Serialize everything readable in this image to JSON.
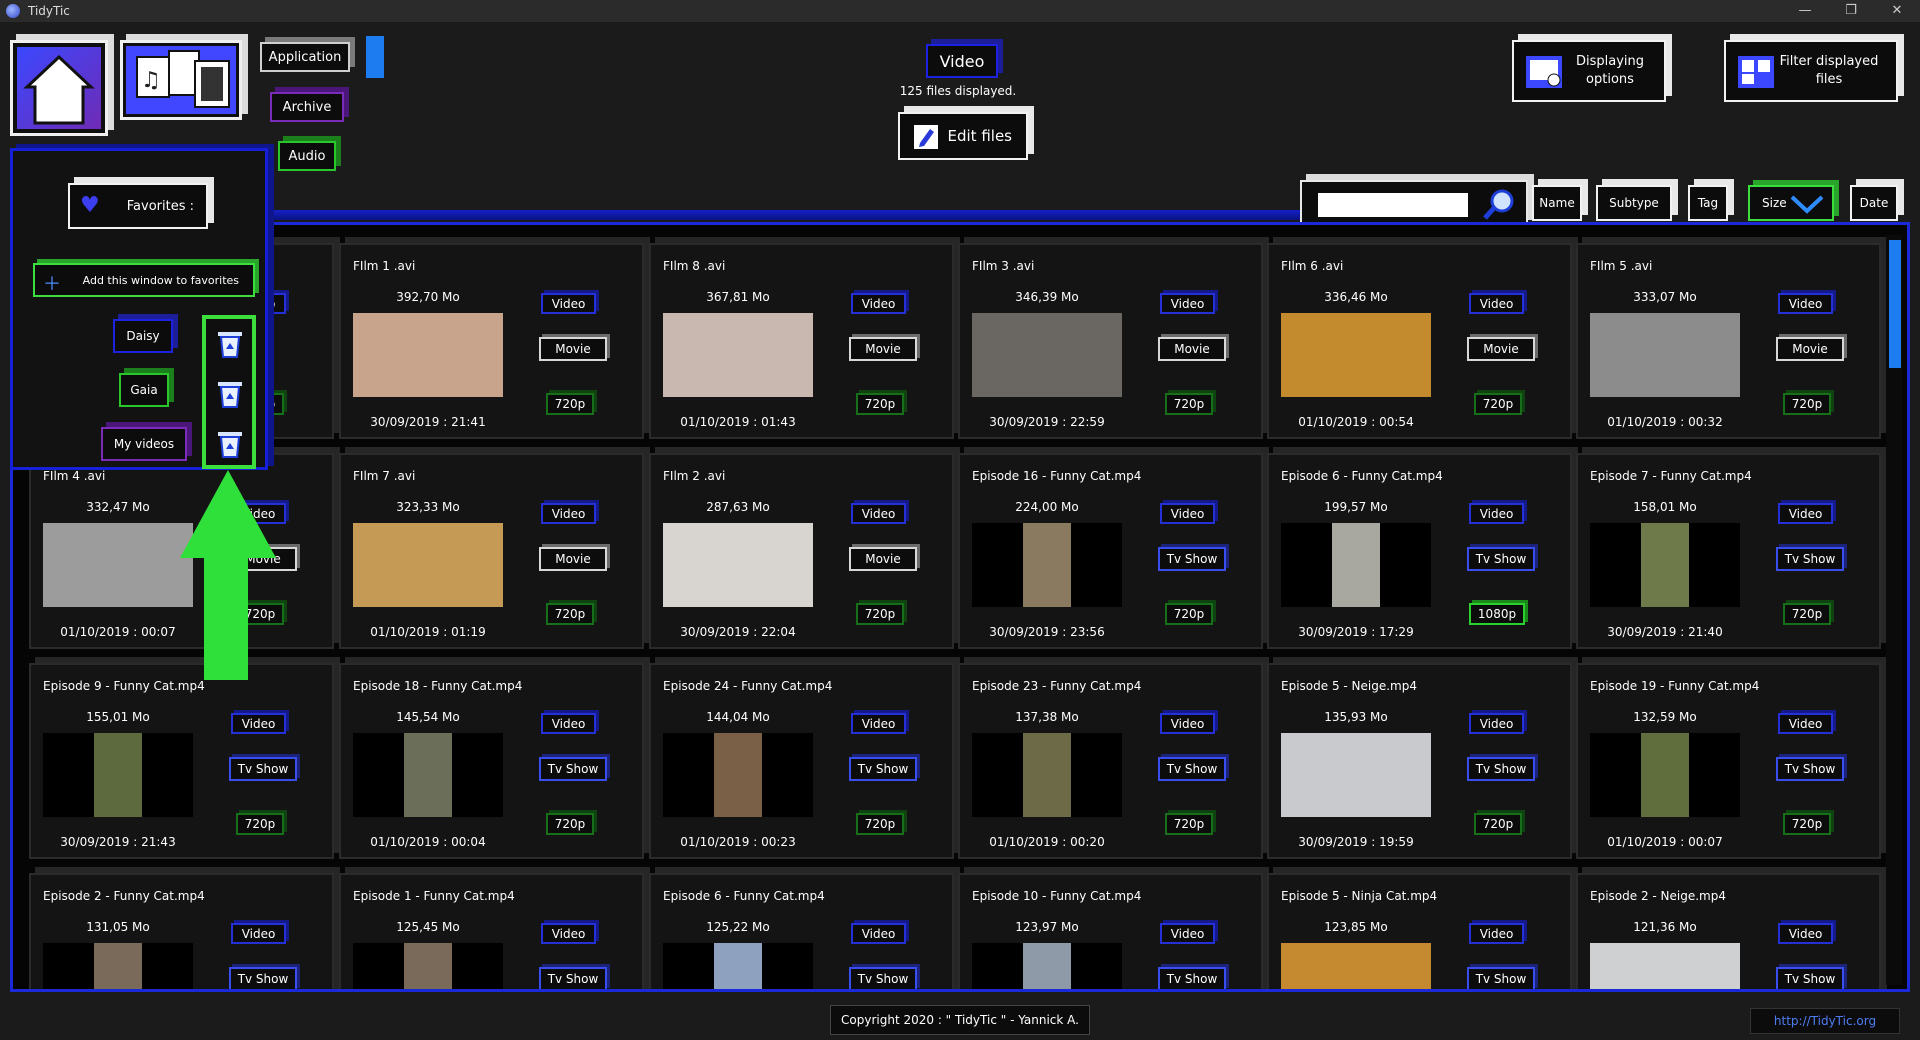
{
  "window": {
    "title": "TidyTic",
    "minimize": "—",
    "restore": "❐",
    "close": "✕"
  },
  "categories": {
    "application": "Application",
    "archive": "Archive",
    "audio": "Audio"
  },
  "current": {
    "category": "Video",
    "files_displayed": "125 files displayed.",
    "edit_files": "Edit files"
  },
  "toolbar": {
    "displaying_options": "Displaying options",
    "filter_displayed_files": "Filter displayed files"
  },
  "sort": {
    "name": "Name",
    "subtype": "Subtype",
    "tag": "Tag",
    "size": "Size",
    "date": "Date"
  },
  "search": {
    "value": ""
  },
  "favorites": {
    "header": "Favorites :",
    "add_button": "Add this window to favorites",
    "items": [
      "Daisy",
      "Gaia",
      "My videos"
    ],
    "colors": [
      "#1d22e0",
      "#29c72b",
      "#7a2bb7"
    ]
  },
  "files": [
    {
      "name": "",
      "size": "",
      "date": "",
      "type": "Video",
      "subtype": "",
      "res": "720p",
      "thumb": "#d7d2c6"
    },
    {
      "name": "FIlm 1 .avi",
      "size": "392,70 Mo",
      "date": "30/09/2019 : 21:41",
      "type": "Video",
      "subtype": "Movie",
      "res": "720p",
      "thumb": "#c9a48d"
    },
    {
      "name": "FIlm 8 .avi",
      "size": "367,81 Mo",
      "date": "01/10/2019 : 01:43",
      "type": "Video",
      "subtype": "Movie",
      "res": "720p",
      "thumb": "#c8b8b0"
    },
    {
      "name": "FIlm 3 .avi",
      "size": "346,39 Mo",
      "date": "30/09/2019 : 22:59",
      "type": "Video",
      "subtype": "Movie",
      "res": "720p",
      "thumb": "#6a6662"
    },
    {
      "name": "FIlm 6 .avi",
      "size": "336,46 Mo",
      "date": "01/10/2019 : 00:54",
      "type": "Video",
      "subtype": "Movie",
      "res": "720p",
      "thumb": "#c48a2e"
    },
    {
      "name": "FIlm 5 .avi",
      "size": "333,07 Mo",
      "date": "01/10/2019 : 00:32",
      "type": "Video",
      "subtype": "Movie",
      "res": "720p",
      "thumb": "#8c8c8c"
    },
    {
      "name": "FIlm 4 .avi",
      "size": "332,47 Mo",
      "date": "01/10/2019 : 00:07",
      "type": "Video",
      "subtype": "Movie",
      "res": "720p",
      "thumb": "#9c9c9c"
    },
    {
      "name": "FIlm 7 .avi",
      "size": "323,33 Mo",
      "date": "01/10/2019 : 01:19",
      "type": "Video",
      "subtype": "Movie",
      "res": "720p",
      "thumb": "#c59a55"
    },
    {
      "name": "FIlm 2 .avi",
      "size": "287,63 Mo",
      "date": "30/09/2019 : 22:04",
      "type": "Video",
      "subtype": "Movie",
      "res": "720p",
      "thumb": "#d8d4cf"
    },
    {
      "name": "Episode 16 - Funny Cat.mp4",
      "size": "224,00 Mo",
      "date": "30/09/2019 : 23:56",
      "type": "Video",
      "subtype": "Tv Show",
      "res": "720p",
      "thumb": "#8a7a60"
    },
    {
      "name": "Episode 6 - Funny Cat.mp4",
      "size": "199,57 Mo",
      "date": "30/09/2019 : 17:29",
      "type": "Video",
      "subtype": "Tv Show",
      "res": "1080p",
      "thumb": "#a8a8a0"
    },
    {
      "name": "Episode 7 - Funny Cat.mp4",
      "size": "158,01 Mo",
      "date": "30/09/2019 : 21:40",
      "type": "Video",
      "subtype": "Tv Show",
      "res": "720p",
      "thumb": "#6f7a4a"
    },
    {
      "name": "Episode 9 - Funny Cat.mp4",
      "size": "155,01 Mo",
      "date": "30/09/2019 : 21:43",
      "type": "Video",
      "subtype": "Tv Show",
      "res": "720p",
      "thumb": "#5d6a3e"
    },
    {
      "name": "Episode 18 - Funny Cat.mp4",
      "size": "145,54 Mo",
      "date": "01/10/2019 : 00:04",
      "type": "Video",
      "subtype": "Tv Show",
      "res": "720p",
      "thumb": "#6b6f5a"
    },
    {
      "name": "Episode 24 - Funny Cat.mp4",
      "size": "144,04 Mo",
      "date": "01/10/2019 : 00:23",
      "type": "Video",
      "subtype": "Tv Show",
      "res": "720p",
      "thumb": "#7a6046"
    },
    {
      "name": "Episode 23 - Funny Cat.mp4",
      "size": "137,38 Mo",
      "date": "01/10/2019 : 00:20",
      "type": "Video",
      "subtype": "Tv Show",
      "res": "720p",
      "thumb": "#6d6a48"
    },
    {
      "name": "Episode 5 - Neige.mp4",
      "size": "135,93 Mo",
      "date": "30/09/2019 : 19:59",
      "type": "Video",
      "subtype": "Tv Show",
      "res": "720p",
      "thumb": "#c9cacd"
    },
    {
      "name": "Episode 19 - Funny Cat.mp4",
      "size": "132,59 Mo",
      "date": "01/10/2019 : 00:07",
      "type": "Video",
      "subtype": "Tv Show",
      "res": "720p",
      "thumb": "#5f6e3c"
    },
    {
      "name": "Episode 2 - Funny Cat.mp4",
      "size": "131,05 Mo",
      "date": "",
      "type": "Video",
      "subtype": "Tv Show",
      "res": "",
      "thumb": "#7a6a5a"
    },
    {
      "name": "Episode 1 - Funny Cat.mp4",
      "size": "125,45 Mo",
      "date": "",
      "type": "Video",
      "subtype": "Tv Show",
      "res": "",
      "thumb": "#7a6a5a"
    },
    {
      "name": "Episode 6 - Funny Cat.mp4",
      "size": "125,22 Mo",
      "date": "",
      "type": "Video",
      "subtype": "Tv Show",
      "res": "",
      "thumb": "#8ea2bf"
    },
    {
      "name": "Episode 10 - Funny Cat.mp4",
      "size": "123,97 Mo",
      "date": "",
      "type": "Video",
      "subtype": "Tv Show",
      "res": "",
      "thumb": "#8e9aa8"
    },
    {
      "name": "Episode 5 - Ninja Cat.mp4",
      "size": "123,85 Mo",
      "date": "",
      "type": "Video",
      "subtype": "Tv Show",
      "res": "",
      "thumb": "#c58a30"
    },
    {
      "name": "Episode 2 - Neige.mp4",
      "size": "121,36 Mo",
      "date": "",
      "type": "Video",
      "subtype": "Tv Show",
      "res": "",
      "thumb": "#cfd0d2"
    }
  ],
  "footer": {
    "copyright": "Copyright 2020 : \" TidyTic \" - Yannick A.",
    "link": "http://TidyTic.org"
  },
  "colors": {
    "accent_blue": "#1a2ad8",
    "accent_green": "#3bde3d",
    "purple": "#7a2bb7"
  }
}
